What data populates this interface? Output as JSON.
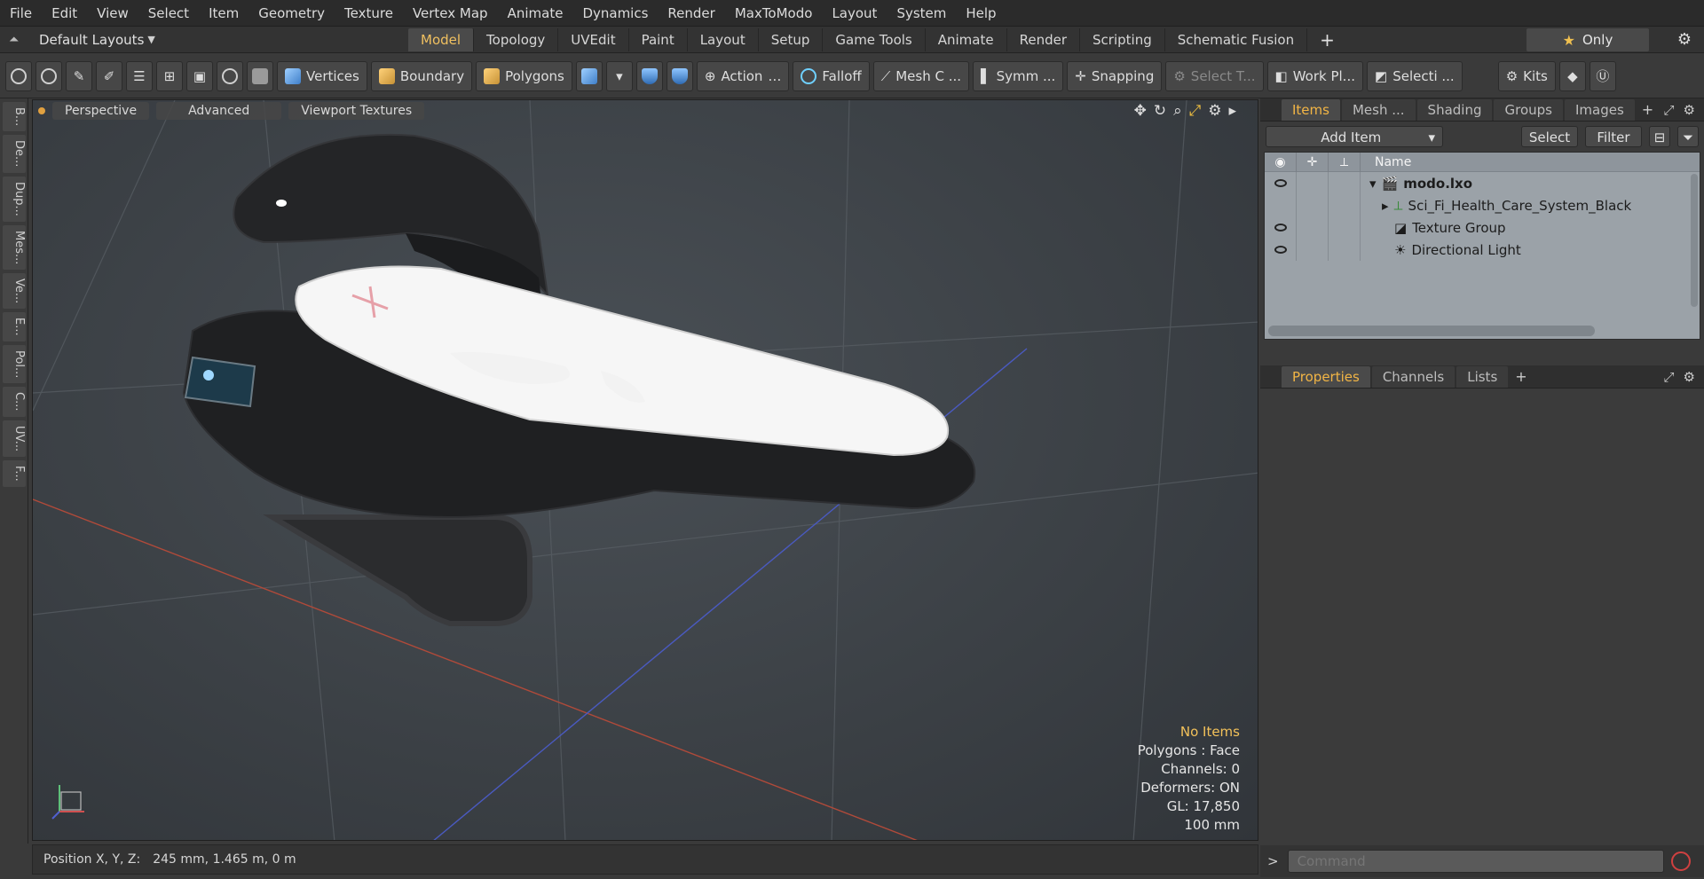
{
  "menu": [
    "File",
    "Edit",
    "View",
    "Select",
    "Item",
    "Geometry",
    "Texture",
    "Vertex Map",
    "Animate",
    "Dynamics",
    "Render",
    "MaxToModo",
    "Layout",
    "System",
    "Help"
  ],
  "layout": {
    "label": "Default Layouts"
  },
  "tabs": [
    "Model",
    "Topology",
    "UVEdit",
    "Paint",
    "Layout",
    "Setup",
    "Game Tools",
    "Animate",
    "Render",
    "Scripting",
    "Schematic Fusion"
  ],
  "only_label": "Only",
  "toolbar": {
    "vertices": "Vertices",
    "boundary": "Boundary",
    "polygons": "Polygons",
    "action": "Action",
    "falloff": "Falloff",
    "mesh": "Mesh C ...",
    "symm": "Symm ...",
    "snapping": "Snapping",
    "select_t": "Select T...",
    "workplane": "Work Pl...",
    "selecti": "Selecti ...",
    "kits": "Kits"
  },
  "left_tabs": [
    "B...",
    "De...",
    "Dup...",
    "Mes...",
    "Ve...",
    "E...",
    "Pol...",
    "C...",
    "UV...",
    "F..."
  ],
  "viewport": {
    "perspective": "Perspective",
    "advanced": "Advanced",
    "textures": "Viewport Textures",
    "hud": {
      "items": "No Items",
      "polygons": "Polygons : Face",
      "channels": "Channels: 0",
      "deformers": "Deformers: ON",
      "gl": "GL: 17,850",
      "scale": "100 mm"
    }
  },
  "status": {
    "label": "Position X, Y, Z:",
    "value": "245 mm, 1.465 m, 0 m"
  },
  "items_panel": {
    "tabs": [
      "Items",
      "Mesh ...",
      "Shading",
      "Groups",
      "Images"
    ],
    "add_item": "Add Item",
    "select": "Select",
    "filter": "Filter",
    "name_col": "Name",
    "rows": [
      "modo.lxo",
      "Sci_Fi_Health_Care_System_Black",
      "Texture Group",
      "Directional Light"
    ]
  },
  "props_panel": {
    "tabs": [
      "Properties",
      "Channels",
      "Lists"
    ]
  },
  "command": {
    "placeholder": "Command"
  },
  "colors": {
    "accent": "#f2b545",
    "hud_yellow": "#f2c15a",
    "tree_bg": "#9ba2a8"
  }
}
